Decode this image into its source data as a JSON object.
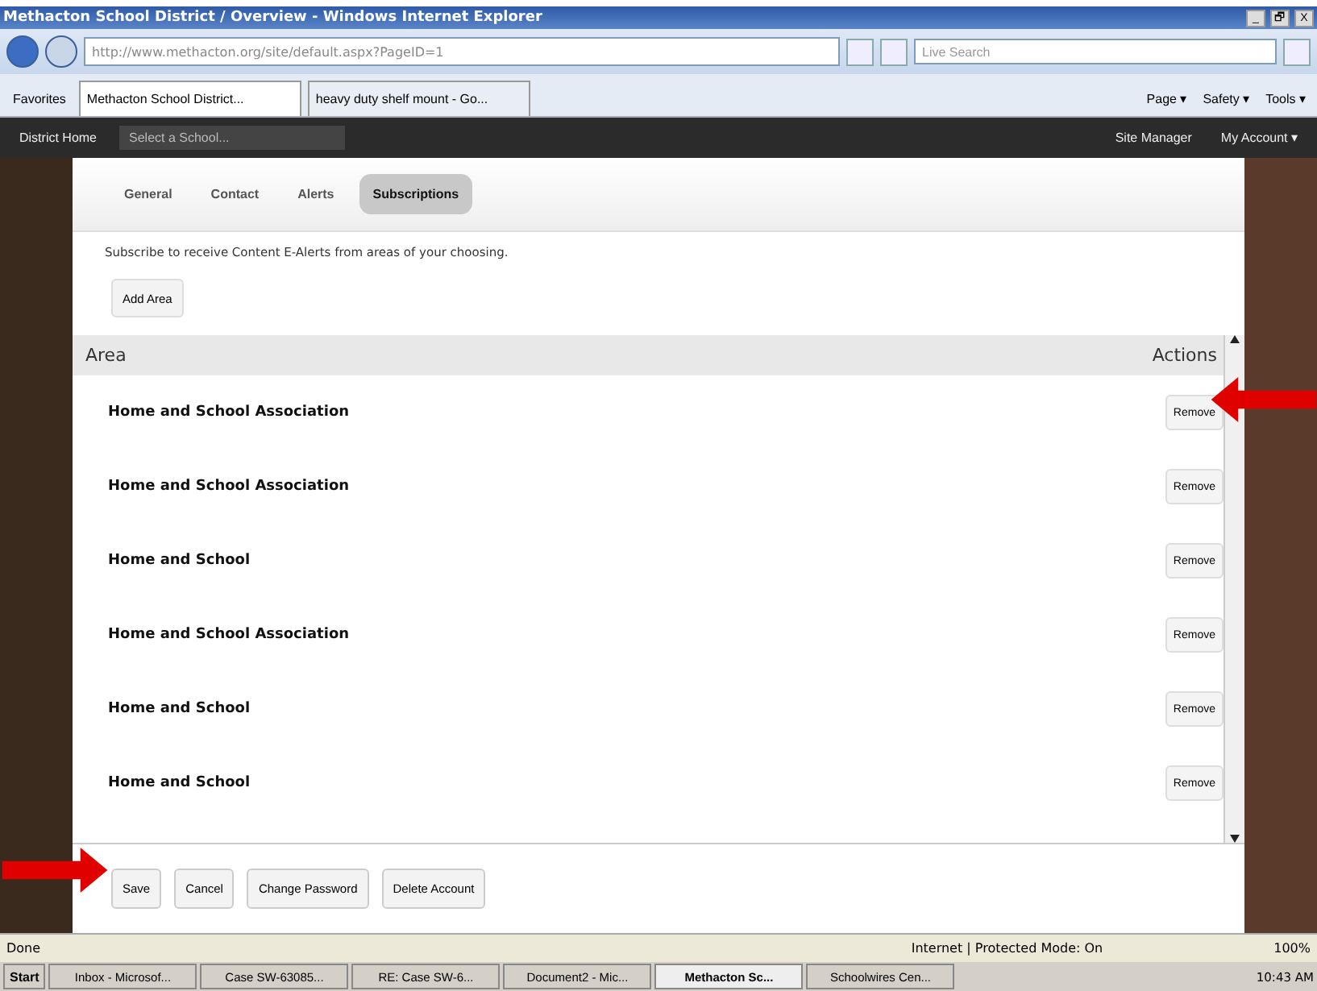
{
  "window": {
    "title": "Methacton School District / Overview - Windows Internet Explorer",
    "controls": [
      "_",
      "🗗",
      "X"
    ]
  },
  "address_bar": {
    "url": "http://www.methacton.org/site/default.aspx?PageID=1",
    "search_placeholder": "Live Search"
  },
  "favorites_label": "Favorites",
  "browser_tabs": [
    {
      "label": "Methacton School District...",
      "selected": true
    },
    {
      "label": "heavy duty shelf mount - Go...",
      "selected": false
    }
  ],
  "command_bar": [
    "Page ▾",
    "Safety ▾",
    "Tools ▾"
  ],
  "site_nav": {
    "home": "District Home",
    "school_select": {
      "placeholder": "Select a School..."
    },
    "right": [
      "Site Manager",
      "My Account ▾"
    ]
  },
  "account_tabs": [
    {
      "label": "General",
      "selected": false
    },
    {
      "label": "Contact",
      "selected": false
    },
    {
      "label": "Alerts",
      "selected": false
    },
    {
      "label": "Subscriptions",
      "selected": true
    }
  ],
  "intro": "Subscribe to receive Content E-Alerts from areas of your choosing.",
  "add_button": "Add Area",
  "table": {
    "columns": [
      "Area",
      "Actions"
    ],
    "rows": [
      {
        "area": "Home and School Association",
        "action": "Remove"
      },
      {
        "area": "Home and School Association",
        "action": "Remove"
      },
      {
        "area": "Home and School",
        "action": "Remove"
      },
      {
        "area": "Home and School Association",
        "action": "Remove"
      },
      {
        "area": "Home and School",
        "action": "Remove"
      },
      {
        "area": "Home and School",
        "action": "Remove"
      }
    ]
  },
  "footer_buttons": [
    "Save",
    "Cancel",
    "Change Password",
    "Delete Account"
  ],
  "status_bar": {
    "text": "Done",
    "zone": "Internet | Protected Mode: On",
    "zoom": "100%"
  },
  "taskbar": {
    "start": "Start",
    "items": [
      {
        "label": "Inbox - Microsof...",
        "selected": false
      },
      {
        "label": "Case SW-63085...",
        "selected": false
      },
      {
        "label": "RE: Case SW-6...",
        "selected": false
      },
      {
        "label": "Document2 - Mic...",
        "selected": false
      },
      {
        "label": "Methacton Sc...",
        "selected": true
      },
      {
        "label": "Schoolwires Cen...",
        "selected": false
      }
    ],
    "clock": "10:43 AM"
  }
}
